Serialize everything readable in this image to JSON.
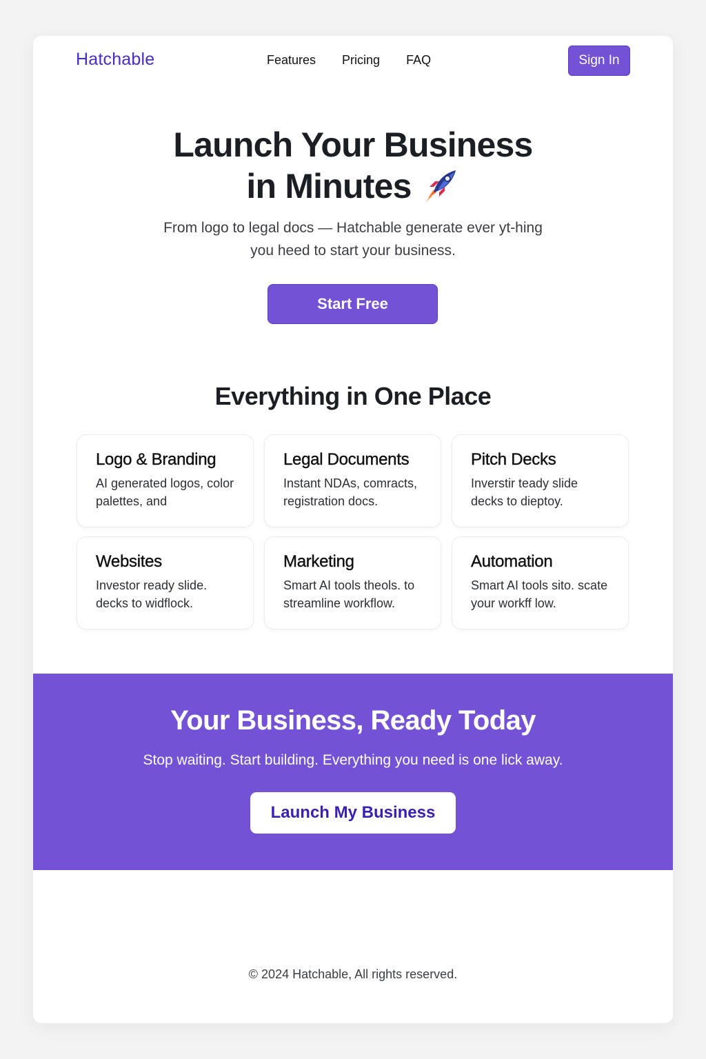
{
  "nav": {
    "logo": "Hatchable",
    "links": [
      "Features",
      "Pricing",
      "FAQ"
    ],
    "sign_in": "Sign In"
  },
  "hero": {
    "title_line1": "Launch Your Business",
    "title_line2": "in Minutes",
    "title_icon": "rocket-icon",
    "subtitle": "From logo to legal docs — Hatchable generate ever yt-hing you heed to start your business.",
    "cta": "Start Free"
  },
  "features": {
    "title": "Everything in One Place",
    "cards": [
      {
        "title": "Logo & Branding",
        "desc": "AI generated logos, color palettes, and"
      },
      {
        "title": "Legal Documents",
        "desc": "Instant NDAs, comracts, registration docs."
      },
      {
        "title": "Pitch Decks",
        "desc": "Inverstir teady slide decks to dieptoy."
      },
      {
        "title": "Websites",
        "desc": "Investor ready slide. decks to widflock."
      },
      {
        "title": "Marketing",
        "desc": "Smart AI tools theols. to streamline workflow."
      },
      {
        "title": "Automation",
        "desc": "Smart AI tools sito. scate your workff low."
      }
    ]
  },
  "cta_band": {
    "title": "Your Business, Ready Today",
    "subtitle": "Stop waiting. Start building. Everything you need is one lick away.",
    "button": "Launch My Business"
  },
  "footer": {
    "copyright": "© 2024 Hatchable, All rights reserved."
  },
  "colors": {
    "brand": "#7352d6",
    "logo": "#4a2bc4",
    "cta_button_text": "#3a1fb0"
  }
}
